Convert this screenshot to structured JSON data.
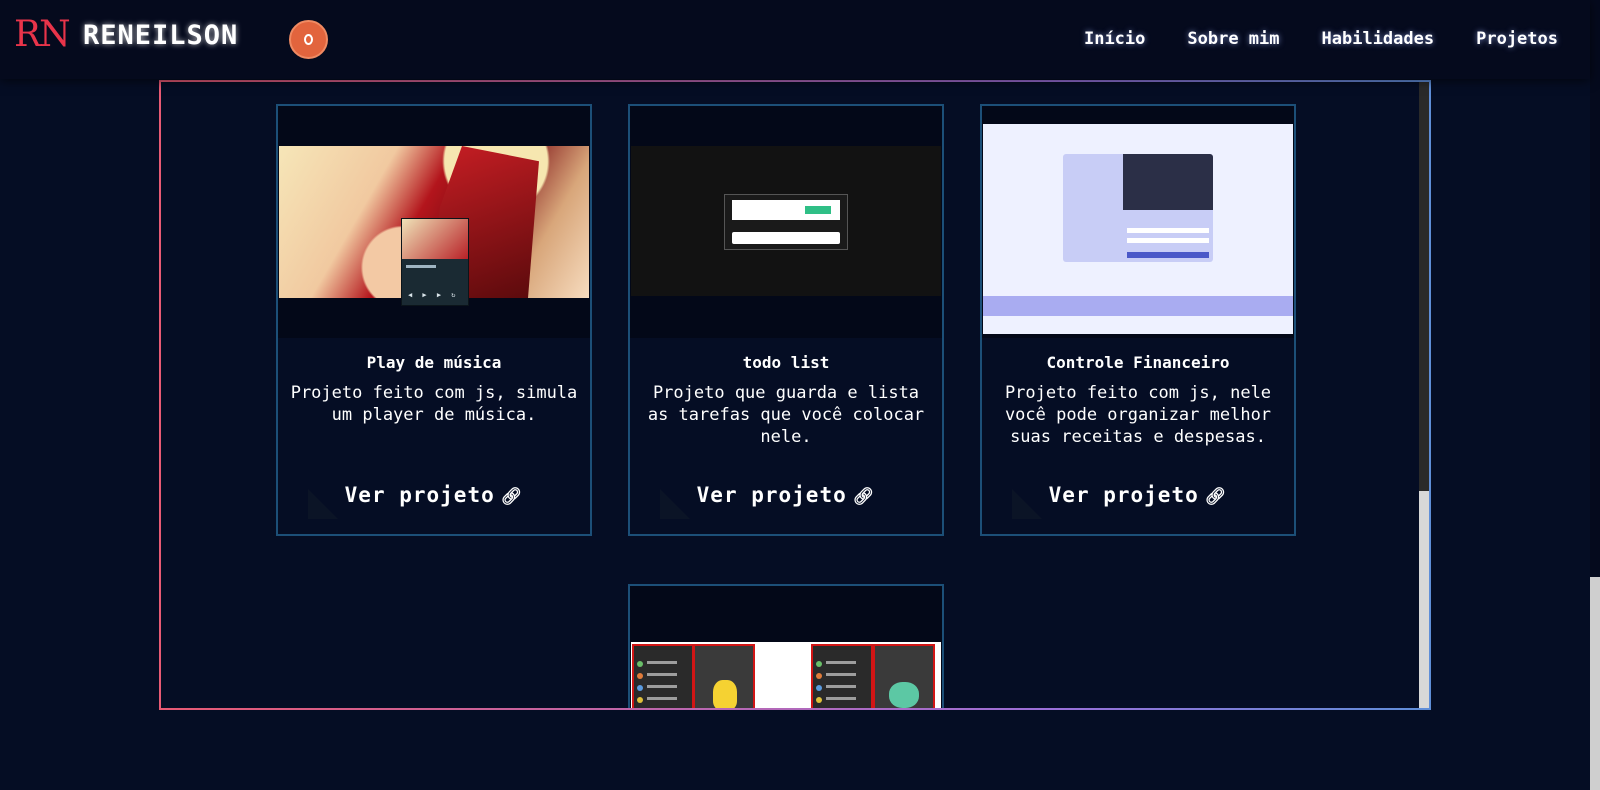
{
  "header": {
    "logo_mark": "RN",
    "brand": "RENEILSON",
    "nav": [
      "Início",
      "Sobre mim",
      "Habilidades",
      "Projetos"
    ]
  },
  "projects": [
    {
      "title": "Play de música",
      "description": "Projeto feito com js, simula um player de música.",
      "link_label": "Ver projeto",
      "thumbnail_icon": "music-player-screenshot"
    },
    {
      "title": "todo list",
      "description": "Projeto que guarda e lista as tarefas que você colocar nele.",
      "link_label": "Ver projeto",
      "thumbnail_icon": "todo-list-screenshot"
    },
    {
      "title": "Controle Financeiro",
      "description": "Projeto feito com js, nele você pode organizar melhor suas receitas e despesas.",
      "link_label": "Ver projeto",
      "thumbnail_icon": "finance-app-screenshot"
    },
    {
      "title": "",
      "description": "",
      "link_label": "",
      "thumbnail_icon": "pokedex-screenshot"
    }
  ],
  "colors": {
    "background": "#050d24",
    "header": "#050a1d",
    "card_border": "#1c4f78",
    "logo_red": "#e8344a",
    "theme_toggle": "#e2643d",
    "frame_gradient": [
      "#e85a74",
      "#9b6fd8",
      "#5f8ed8"
    ]
  },
  "icons": {
    "link": "link-icon",
    "theme_toggle": "theme-toggle-icon"
  }
}
